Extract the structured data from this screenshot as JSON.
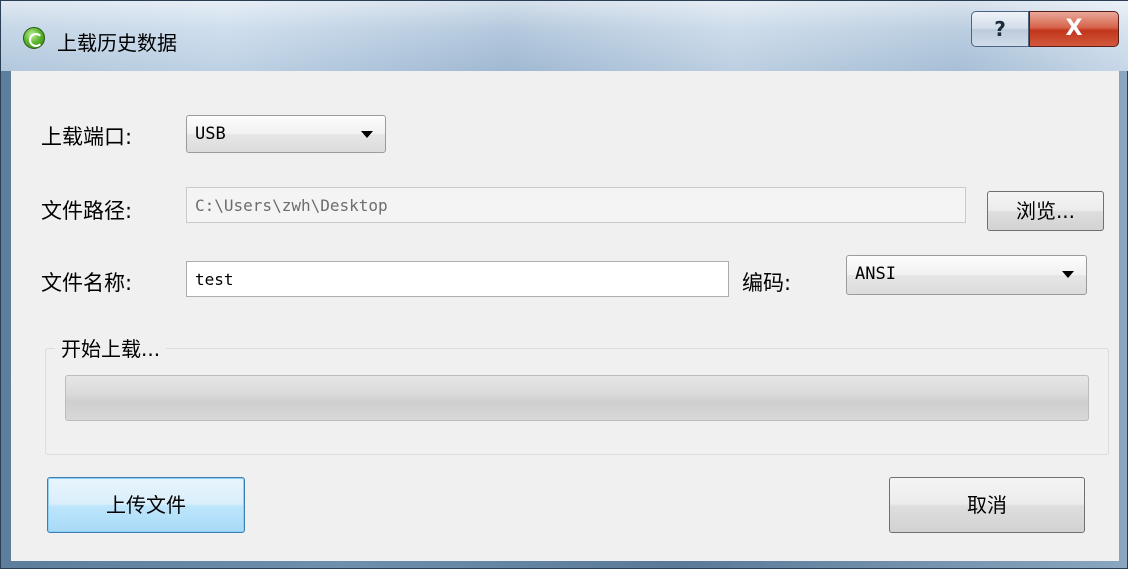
{
  "window": {
    "title": "上载历史数据",
    "help_label": "?",
    "close_label": "X"
  },
  "form": {
    "port_label": "上载端口:",
    "port_value": "USB",
    "path_label": "文件路径:",
    "path_value": "C:\\Users\\zwh\\Desktop",
    "browse_label": "浏览...",
    "filename_label": "文件名称:",
    "filename_value": "test",
    "encoding_label": "编码:",
    "encoding_value": "ANSI"
  },
  "upload": {
    "group_title": "开始上载...",
    "progress": 0
  },
  "actions": {
    "upload_label": "上传文件",
    "cancel_label": "取消"
  }
}
